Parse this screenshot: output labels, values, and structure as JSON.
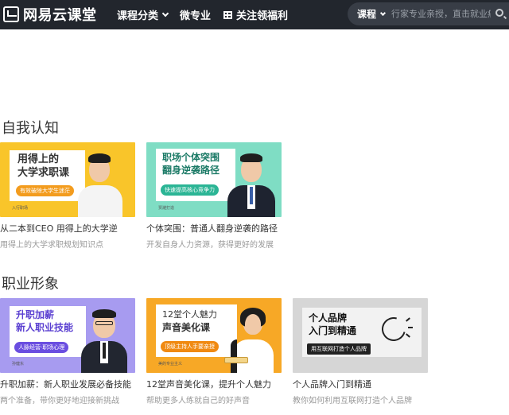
{
  "header": {
    "logo_text": "网易云课堂",
    "nav_category": "课程分类",
    "nav_micro": "微专业",
    "nav_follow": "关注领福利",
    "search_type": "课程",
    "search_placeholder": "行家专业亲授，直击就业痛"
  },
  "sections": [
    {
      "title": "自我认知",
      "courses": [
        {
          "thumb_title_1": "用得上的",
          "thumb_title_2": "大学求职课",
          "thumb_pill": "有效破除大学生迷茫",
          "thumb_tag": "入行职场",
          "title": "从二本到CEO 用得上的大学逆",
          "desc": "用得上的大学求职规划知识点"
        },
        {
          "thumb_title_1": "职场个体突围",
          "thumb_title_2": "翻身逆袭路径",
          "thumb_pill": "快速提高核心竞争力",
          "thumb_tag": "贾潍打造",
          "title": "个体突围：普通人翻身逆袭的路径",
          "desc": "开发自身人力资源，获得更好的发展"
        }
      ]
    },
    {
      "title": "职业形象",
      "courses": [
        {
          "thumb_title_1": "升职加薪",
          "thumb_title_2": "新人职业技能",
          "thumb_pill": "人脉经营·职场心理",
          "thumb_tag": "孙健东",
          "title": "升职加薪：新人职业发展必备技能",
          "desc": "两个准备，带你更好地迎接新挑战"
        },
        {
          "thumb_title_1": "12堂个人魅力",
          "thumb_title_2": "声音美化课",
          "thumb_pill": "顶级主持人手要亲授",
          "thumb_tag": "美的专业主义",
          "title": "12堂声音美化课，提升个人魅力",
          "desc": "帮助更多人练就自己的好声音"
        },
        {
          "thumb_title_1": "个人品牌",
          "thumb_title_2": "入门到精通",
          "thumb_pill": "用互联网打造个人品牌",
          "title": "个人品牌入门到精通",
          "desc": "教你如何利用互联网打造个人品牌"
        }
      ]
    }
  ],
  "colors": {
    "header_bg": "#22262d",
    "thumb_yellow": "#f9c52a",
    "thumb_mint": "#7fddc4",
    "thumb_purple": "#a79bf0",
    "thumb_orange": "#f7a826",
    "thumb_gray": "#d6d6d6"
  }
}
